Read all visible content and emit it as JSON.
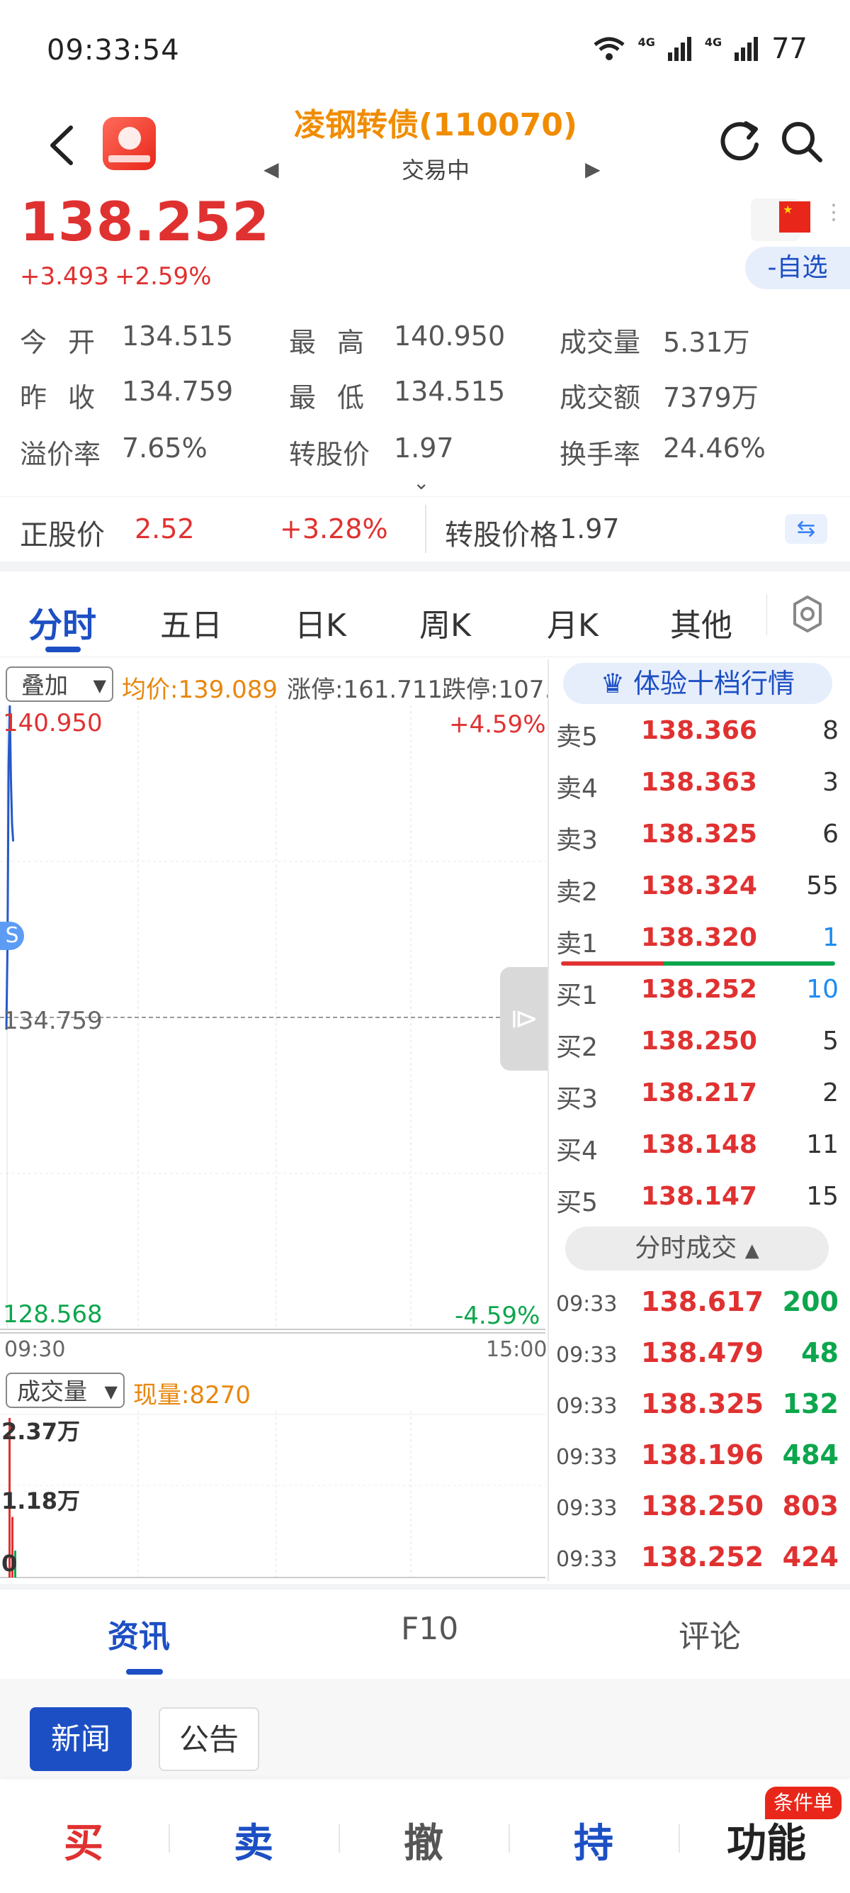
{
  "status_bar": {
    "time": "09:33:54",
    "battery": "77",
    "net1": "4G",
    "net2": "4G"
  },
  "header": {
    "title": "凌钢转债(110070)",
    "subtitle": "交易中"
  },
  "quote": {
    "price": "138.252",
    "change": "+3.493",
    "change_pct": "+2.59%",
    "watch_label": "-自选",
    "rows": [
      [
        {
          "label": "今开",
          "value": "134.515"
        },
        {
          "label": "最高",
          "value": "140.950"
        },
        {
          "label": "成交量",
          "value": "5.31万"
        }
      ],
      [
        {
          "label": "昨收",
          "value": "134.759"
        },
        {
          "label": "最低",
          "value": "134.515"
        },
        {
          "label": "成交额",
          "value": "7379万"
        }
      ],
      [
        {
          "label": "溢价率",
          "value": "7.65%"
        },
        {
          "label": "转股价",
          "value": "1.97"
        },
        {
          "label": "换手率",
          "value": "24.46%"
        }
      ]
    ]
  },
  "stock_row": {
    "label": "正股价",
    "price": "2.52",
    "pct": "+3.28%",
    "conv_label": "转股价格",
    "conv_value": "1.97"
  },
  "tabs": [
    "分时",
    "五日",
    "日K",
    "周K",
    "月K",
    "其他"
  ],
  "chart_header": {
    "overlay": "叠加",
    "avg": "均价:139.089",
    "limit_up": "涨停:161.711",
    "limit_down": "跌停:107."
  },
  "chart_data": {
    "type": "line",
    "y_top": "140.950",
    "y_mid": "134.759",
    "y_bottom": "128.568",
    "pct_top": "+4.59%",
    "pct_bottom": "-4.59%",
    "x_start": "09:30",
    "x_end": "15:00",
    "ylim": [
      128.568,
      140.95
    ],
    "series": [
      {
        "values": [
          134.515,
          136.2,
          139.8,
          140.95,
          139.5,
          138.6,
          138.252
        ]
      }
    ],
    "volume": {
      "label": "成交量",
      "current": "现量:8270",
      "ticks": [
        "2.37万",
        "1.18万",
        "0"
      ],
      "values": [
        23700,
        9000,
        4000
      ]
    }
  },
  "order_book": {
    "banner": "体验十档行情",
    "asks": [
      {
        "label": "卖5",
        "price": "138.366",
        "vol": "8"
      },
      {
        "label": "卖4",
        "price": "138.363",
        "vol": "3"
      },
      {
        "label": "卖3",
        "price": "138.325",
        "vol": "6"
      },
      {
        "label": "卖2",
        "price": "138.324",
        "vol": "55"
      },
      {
        "label": "卖1",
        "price": "138.320",
        "vol": "1"
      }
    ],
    "bids": [
      {
        "label": "买1",
        "price": "138.252",
        "vol": "10"
      },
      {
        "label": "买2",
        "price": "138.250",
        "vol": "5"
      },
      {
        "label": "买3",
        "price": "138.217",
        "vol": "2"
      },
      {
        "label": "买4",
        "price": "138.148",
        "vol": "11"
      },
      {
        "label": "买5",
        "price": "138.147",
        "vol": "15"
      }
    ],
    "ticks_label": "分时成交",
    "ticks": [
      {
        "time": "09:33",
        "price": "138.617",
        "vol": "200",
        "color": "#0ca64d"
      },
      {
        "time": "09:33",
        "price": "138.479",
        "vol": "48",
        "color": "#0ca64d"
      },
      {
        "time": "09:33",
        "price": "138.325",
        "vol": "132",
        "color": "#0ca64d"
      },
      {
        "time": "09:33",
        "price": "138.196",
        "vol": "484",
        "color": "#0ca64d"
      },
      {
        "time": "09:33",
        "price": "138.250",
        "vol": "803",
        "color": "#e03131"
      },
      {
        "time": "09:33",
        "price": "138.252",
        "vol": "424",
        "color": "#e03131"
      }
    ]
  },
  "info_tabs": [
    "资讯",
    "F10",
    "评论"
  ],
  "info_buttons": {
    "news": "新闻",
    "notice": "公告"
  },
  "bottom_bar": {
    "buy": "买",
    "sell": "卖",
    "cancel": "撤",
    "hold": "持",
    "func": "功能",
    "tag": "条件单"
  }
}
